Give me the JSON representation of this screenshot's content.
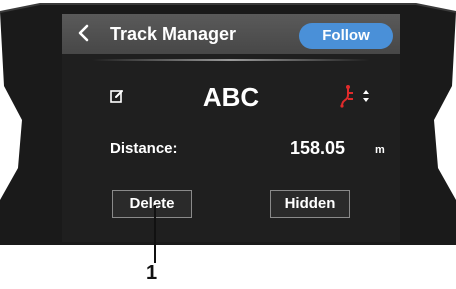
{
  "header": {
    "title": "Track Manager",
    "follow_label": "Follow"
  },
  "track": {
    "name": "ABC",
    "distance_label": "Distance:",
    "distance_value": "158.05",
    "distance_unit": "m"
  },
  "actions": {
    "delete_label": "Delete",
    "hidden_label": "Hidden"
  },
  "callout": {
    "number": "1"
  },
  "colors": {
    "accent": "#4a90d8",
    "track_icon": "#e02b2b",
    "screen_bg": "#1f1f1f",
    "header_bg": "#505050"
  },
  "icons": [
    "back-chevron-icon",
    "edit-icon",
    "track-route-icon",
    "up-down-icon"
  ]
}
